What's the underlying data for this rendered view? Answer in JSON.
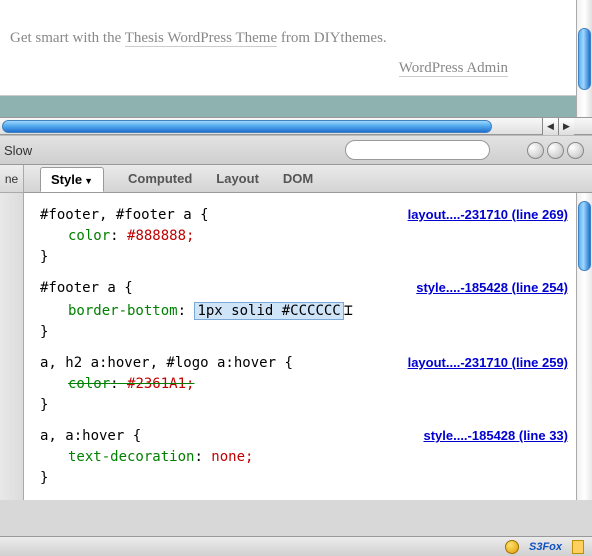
{
  "page": {
    "footer_prefix": "Get smart with the ",
    "footer_link": "Thesis WordPress Theme",
    "footer_suffix": " from DIYthemes.",
    "admin_link": "WordPress Admin"
  },
  "toolbar": {
    "label": "Slow",
    "search_value": ""
  },
  "tabs": {
    "ne_label": "ne",
    "style": "Style",
    "computed": "Computed",
    "layout": "Layout",
    "dom": "DOM"
  },
  "rules": [
    {
      "selector": "#footer, #footer a",
      "source": "layout....-231710 (line 269)",
      "decls": [
        {
          "prop": "color",
          "val": "#888888",
          "edit": false,
          "struck": false
        }
      ]
    },
    {
      "selector": "#footer a",
      "source": "style....-185428 (line 254)",
      "decls": [
        {
          "prop": "border-bottom",
          "val": "1px solid #CCCCCC",
          "edit": true,
          "struck": false
        }
      ]
    },
    {
      "selector": "a, h2 a:hover, #logo a:hover",
      "source": "layout....-231710 (line 259)",
      "decls": [
        {
          "prop": "color",
          "val": "#2361A1",
          "edit": false,
          "struck": true
        }
      ]
    },
    {
      "selector": "a, a:hover",
      "source": "style....-185428 (line 33)",
      "decls": [
        {
          "prop": "text-decoration",
          "val": "none",
          "edit": false,
          "struck": false
        }
      ]
    }
  ],
  "status": {
    "s3fox": "S3Fox"
  }
}
